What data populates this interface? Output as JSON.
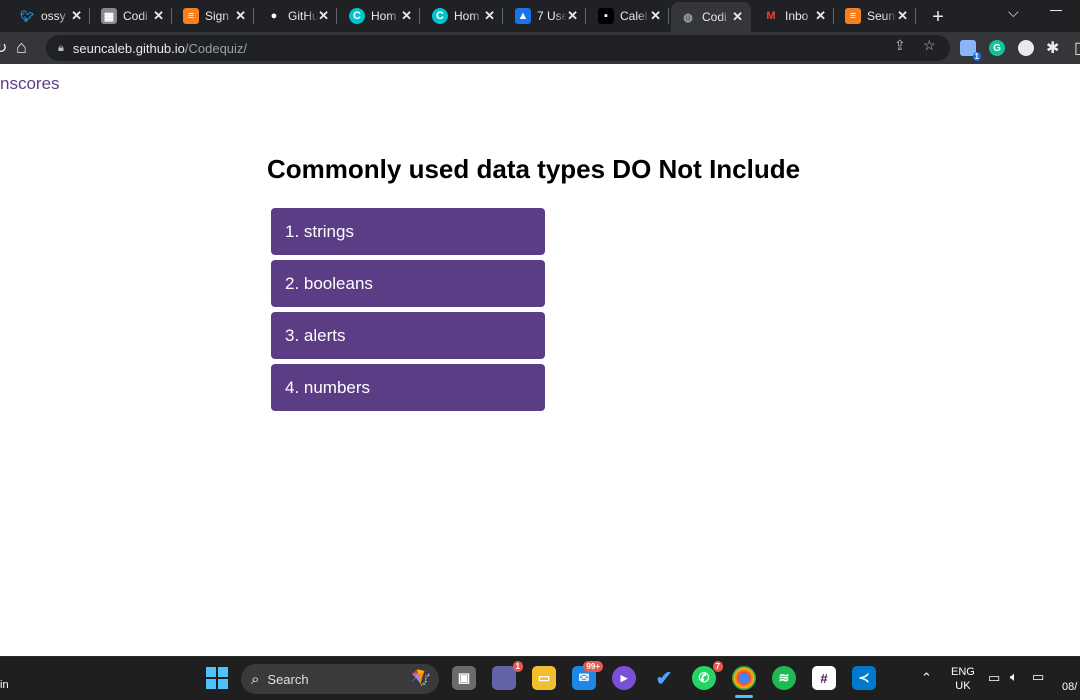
{
  "browser": {
    "tabs": [
      {
        "title": "ossy",
        "icon": "twitter-icon",
        "color": "#1d9bf0"
      },
      {
        "title": "Codi",
        "icon": "github-pages-icon",
        "color": "#8a8a8a"
      },
      {
        "title": "Sign",
        "icon": "stackoverflow-icon",
        "color": "#f48024"
      },
      {
        "title": "GitHu",
        "icon": "github-icon",
        "color": "#ffffff"
      },
      {
        "title": "Hom",
        "icon": "canva-icon",
        "color": "#00c4cc"
      },
      {
        "title": "Hom",
        "icon": "canva-icon",
        "color": "#00c4cc"
      },
      {
        "title": "7 Use",
        "icon": "arrow-up-icon",
        "color": "#1a73e8"
      },
      {
        "title": "Calel",
        "icon": "calendar-icon",
        "color": "#000000"
      },
      {
        "title": "Codi",
        "icon": "globe-icon",
        "color": "#9aa0a6",
        "active": true
      },
      {
        "title": "Inbo",
        "icon": "gmail-icon",
        "color": "#ea4335"
      },
      {
        "title": "Seun",
        "icon": "stackoverflow-icon",
        "color": "#f48024"
      }
    ],
    "address": {
      "host": "seuncaleb.github.io",
      "path": "/Codequiz/"
    },
    "extension_badge": "1",
    "grammarly_label": "G"
  },
  "page": {
    "highscores_link": "nscores",
    "question": "Commonly used data types DO Not Include",
    "choices": [
      "1. strings",
      "2. booleans",
      "3. alerts",
      "4. numbers"
    ]
  },
  "taskbar": {
    "left_text": "in",
    "search_placeholder": "Search",
    "badges": {
      "teams": "1",
      "mail": "99+",
      "whatsapp": "7"
    },
    "language": {
      "line1": "ENG",
      "line2": "UK"
    },
    "clock": "08/"
  }
}
